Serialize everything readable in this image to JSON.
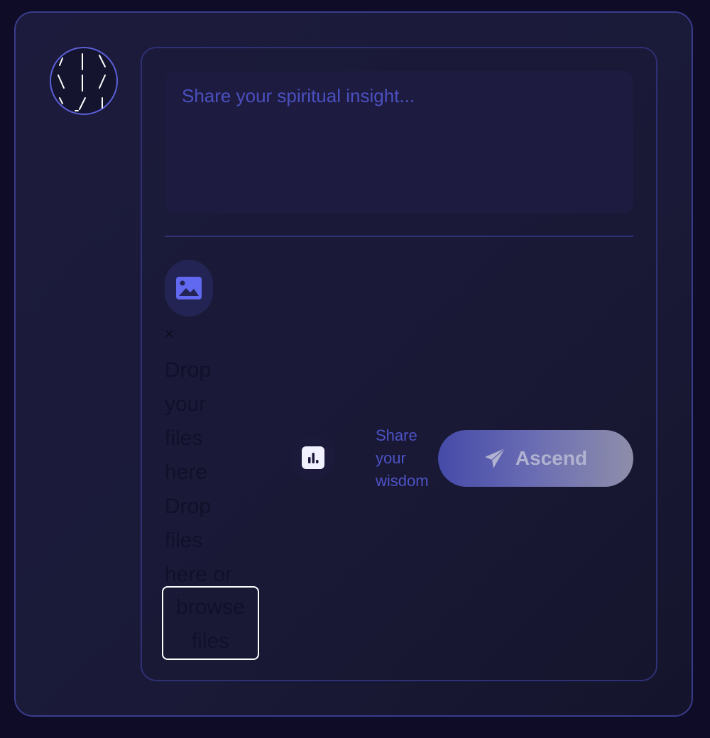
{
  "composer": {
    "placeholder": "Share your spiritual insight...",
    "value": ""
  },
  "toolbar": {
    "media_icon": "image-icon",
    "close_label": "×",
    "dropzone_text": "Drop your files here Drop files here or",
    "browse_label": "browse files",
    "poll_icon": "bar-chart-icon",
    "hint": "Share your wisdom",
    "submit_icon": "paper-plane-icon",
    "submit_label": "Ascend"
  },
  "avatar": {
    "icon": "sacred-symbol-icon"
  },
  "colors": {
    "background": "#0e0c26",
    "card": "#1c1b3d",
    "border": "#3a3b8c",
    "accent": "#5b5fd6",
    "placeholder": "#4b4fc0"
  }
}
